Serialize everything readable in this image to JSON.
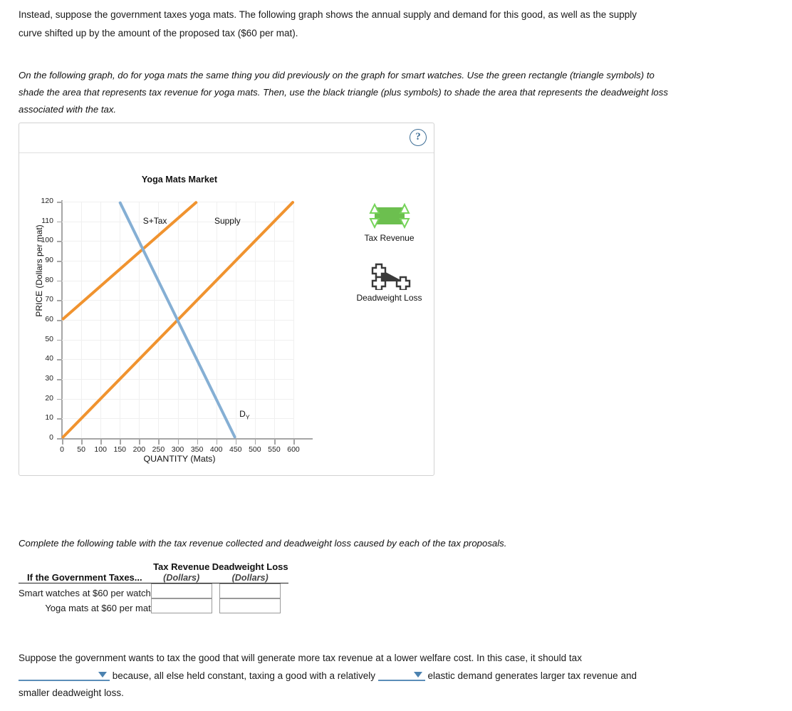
{
  "intro": {
    "text": "Instead, suppose the government taxes yoga mats. The following graph shows the annual supply and demand for this good, as well as the supply curve shifted up by the amount of the proposed tax ($60 per mat)."
  },
  "instruction": {
    "text": "On the following graph, do for yoga mats the same thing you did previously on the graph for smart watches. Use the green rectangle (triangle symbols) to shade the area that represents tax revenue for yoga mats. Then, use the black triangle (plus symbols) to shade the area that represents the deadweight loss associated with the tax."
  },
  "graph_panel": {
    "help_label": "?",
    "legend": [
      {
        "id": "tax-revenue",
        "label": "Tax Revenue",
        "icon": "green-rectangle-triangle-handles",
        "color": "#6cbf4f"
      },
      {
        "id": "deadweight-loss",
        "label": "Deadweight Loss",
        "icon": "black-triangle-plus-handles",
        "color": "#3a3a3a"
      }
    ]
  },
  "chart_data": {
    "type": "line",
    "title": "Yoga Mats Market",
    "xlabel": "QUANTITY (Mats)",
    "ylabel": "PRICE (Dollars per mat)",
    "xlim": [
      0,
      600
    ],
    "ylim": [
      0,
      120
    ],
    "xticks": [
      0,
      50,
      100,
      150,
      200,
      250,
      300,
      350,
      400,
      450,
      500,
      550,
      600
    ],
    "yticks": [
      0,
      10,
      20,
      30,
      40,
      50,
      60,
      70,
      80,
      90,
      100,
      110,
      120
    ],
    "grid": true,
    "legend_position": "inline-labels",
    "series": [
      {
        "name": "Supply",
        "label": "Supply",
        "color": "#f0932f",
        "points": [
          [
            0,
            0
          ],
          [
            600,
            120
          ]
        ],
        "label_at": [
          395,
          110
        ]
      },
      {
        "name": "S+Tax",
        "label": "S+Tax",
        "color": "#f0932f",
        "points": [
          [
            0,
            60
          ],
          [
            350,
            120
          ]
        ],
        "label_at": [
          210,
          110
        ]
      },
      {
        "name": "Demand",
        "label": "D",
        "label_sub": "Y",
        "color": "#85afd4",
        "points": [
          [
            150,
            120
          ],
          [
            450,
            0
          ]
        ],
        "label_at": [
          460,
          12
        ]
      }
    ],
    "annotations": {
      "equilibrium_no_tax": [
        300,
        60
      ],
      "equilibrium_with_tax": [
        200,
        100
      ]
    }
  },
  "table_section": {
    "intro": "Complete the following table with the tax revenue collected and deadweight loss caused by each of the tax proposals.",
    "row_header": "If the Government Taxes...",
    "columns": [
      {
        "title": "Tax Revenue",
        "units": "(Dollars)"
      },
      {
        "title": "Deadweight Loss",
        "units": "(Dollars)"
      }
    ],
    "rows": [
      {
        "label": "Smart watches at $60 per watch",
        "tax_revenue": "",
        "deadweight_loss": ""
      },
      {
        "label": "Yoga mats at $60 per mat",
        "tax_revenue": "",
        "deadweight_loss": ""
      }
    ]
  },
  "closing": {
    "part1": "Suppose the government wants to tax the good that will generate more tax revenue at a lower welfare cost. In this case, it should tax",
    "dropdown1_value": "",
    "part2": "because, all else held constant, taxing a good with a relatively",
    "dropdown2_value": "",
    "part3": "elastic demand generates larger tax revenue and smaller deadweight loss."
  }
}
